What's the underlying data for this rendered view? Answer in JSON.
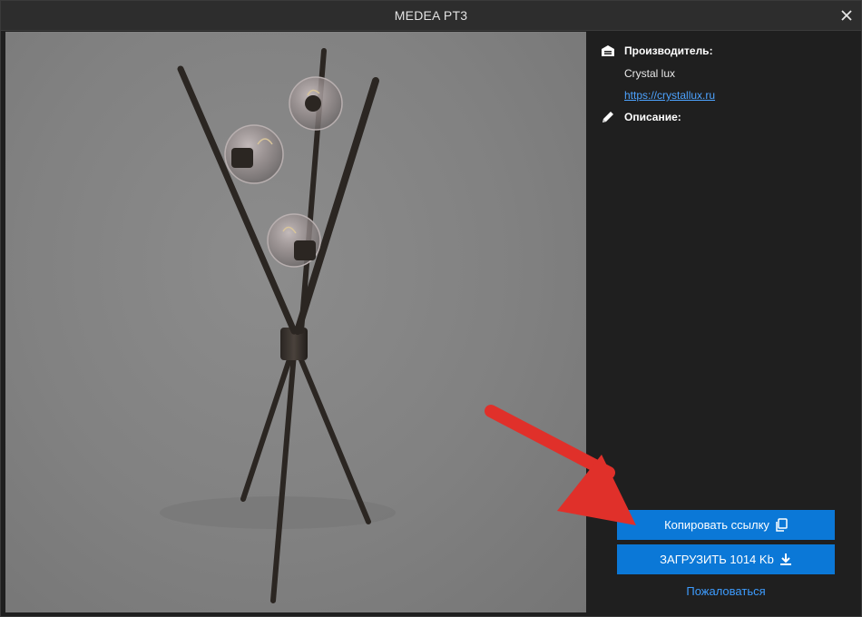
{
  "window": {
    "title": "MEDEA PT3",
    "close_icon": "close-icon"
  },
  "preview": {
    "image": "floor-lamp-3d-render"
  },
  "info": {
    "manufacturer_label": "Производитель:",
    "manufacturer_icon": "factory-icon",
    "manufacturer_name": "Crystal lux",
    "manufacturer_url": "https://crystallux.ru",
    "description_label": "Описание:",
    "description_icon": "pencil-icon"
  },
  "actions": {
    "copy_link_label": "Копировать ссылку",
    "copy_icon": "copy-icon",
    "download_label": "ЗАГРУЗИТЬ 1014 Kb",
    "download_icon": "download-icon",
    "complain_label": "Пожаловаться"
  },
  "colors": {
    "accent": "#0b78d7",
    "link": "#4da3ff",
    "background": "#1f1f1f",
    "annotation_arrow": "#e0302a"
  }
}
